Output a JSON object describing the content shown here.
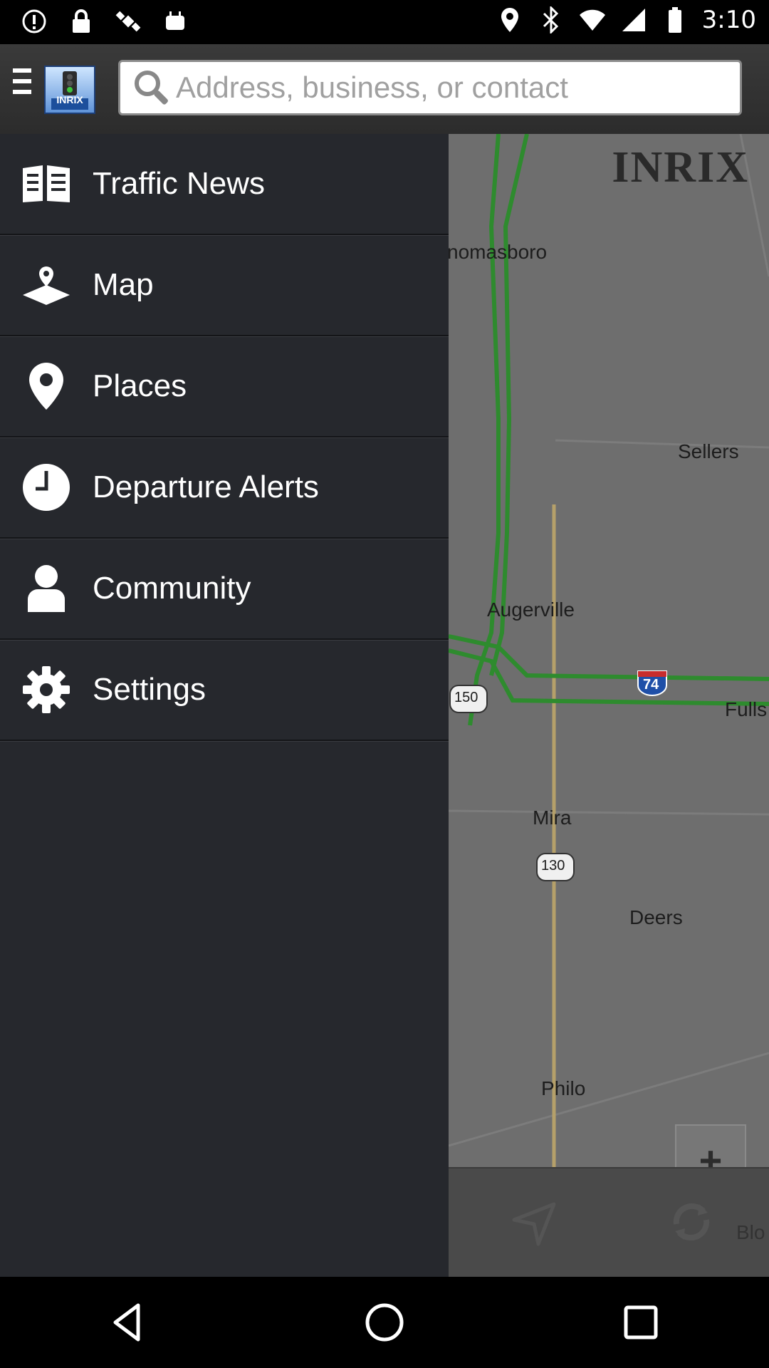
{
  "status_bar": {
    "time": "3:10",
    "left_icons": [
      "alert-icon",
      "lock-icon",
      "fake-gps-icon",
      "android-icon"
    ],
    "right_icons": [
      "location-icon",
      "bluetooth-icon",
      "wifi-icon",
      "signal-icon",
      "battery-icon"
    ]
  },
  "header": {
    "logo_text": "INRIX",
    "search_placeholder": "Address, business, or contact"
  },
  "drawer": {
    "items": [
      {
        "label": "Traffic News",
        "icon": "newspaper-icon"
      },
      {
        "label": "Map",
        "icon": "map-pin-icon"
      },
      {
        "label": "Places",
        "icon": "location-pin-icon"
      },
      {
        "label": "Departure Alerts",
        "icon": "clock-icon"
      },
      {
        "label": "Community",
        "icon": "person-icon"
      },
      {
        "label": "Settings",
        "icon": "gear-icon"
      }
    ]
  },
  "map": {
    "brand": "INRIX",
    "labels": [
      "nomasboro",
      "Sellers",
      "Augerville",
      "Fulls",
      "Mira",
      "Deers",
      "Philo",
      "Blo"
    ],
    "route_shields": [
      "150",
      "74",
      "130"
    ],
    "zoom_in": "+",
    "zoom_out": "−"
  },
  "colors": {
    "drawer_bg": "#26282d",
    "map_bg": "#6e6e6e",
    "road_green": "#2e8b2e"
  }
}
